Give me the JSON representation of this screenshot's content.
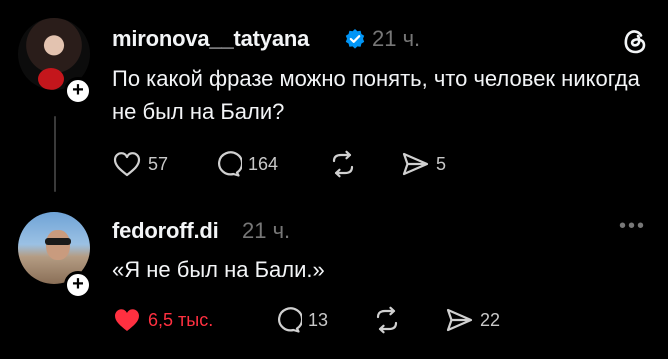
{
  "post1": {
    "username": "mironova__tatyana",
    "time": "21 ч.",
    "text": "По какой фразе можно понять, что человек никогда не был на Бали?",
    "likes": "57",
    "comments": "164",
    "shares": "5"
  },
  "post2": {
    "username": "fedoroff.di",
    "time": "21 ч.",
    "text": "«Я не был на Бали.»",
    "likes": "6,5 тыс.",
    "comments": "13",
    "shares": "22"
  },
  "icons": {
    "verified": "verified-badge-icon",
    "threads": "threads-logo-icon",
    "like": "heart-icon",
    "comment": "comment-bubble-icon",
    "repost": "repost-icon",
    "share": "send-icon",
    "more": "more-icon"
  },
  "colors": {
    "background": "#000000",
    "liked": "#ff3040",
    "verified": "#0095f6",
    "muted": "#777777"
  }
}
